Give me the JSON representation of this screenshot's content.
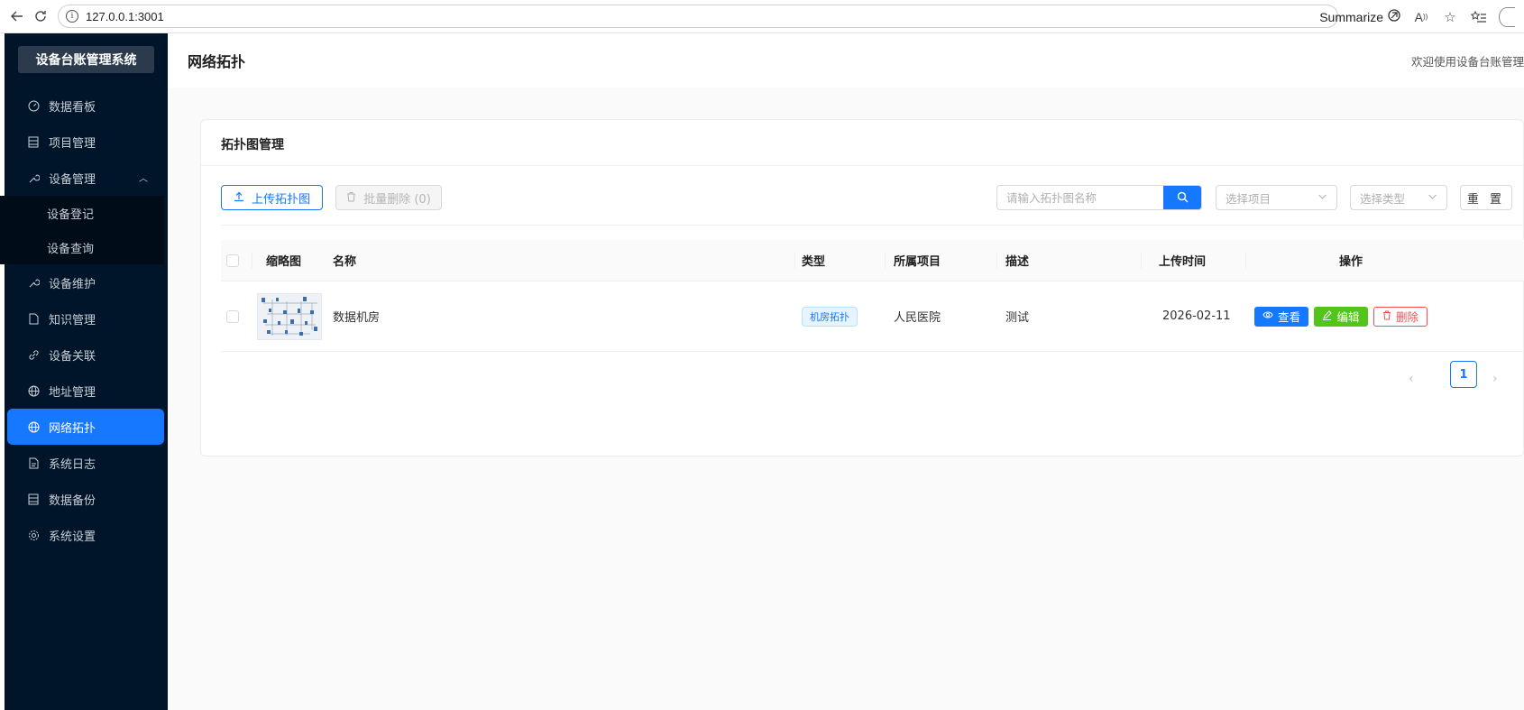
{
  "browser": {
    "url": "127.0.0.1:3001",
    "summarize_label": "Summarize"
  },
  "sidebar": {
    "brand": "设备台账管理系统",
    "items": [
      {
        "label": "数据看板",
        "icon": "dashboard-icon"
      },
      {
        "label": "项目管理",
        "icon": "list-icon"
      },
      {
        "label": "设备管理",
        "icon": "wrench-icon",
        "expanded": true,
        "children": [
          {
            "label": "设备登记"
          },
          {
            "label": "设备查询"
          }
        ]
      },
      {
        "label": "设备维护",
        "icon": "wrench-icon"
      },
      {
        "label": "知识管理",
        "icon": "file-icon"
      },
      {
        "label": "设备关联",
        "icon": "link-icon"
      },
      {
        "label": "地址管理",
        "icon": "globe-icon"
      },
      {
        "label": "网络拓扑",
        "icon": "globe-icon",
        "active": true
      },
      {
        "label": "系统日志",
        "icon": "file-text-icon"
      },
      {
        "label": "数据备份",
        "icon": "list-icon"
      },
      {
        "label": "系统设置",
        "icon": "gear-icon"
      }
    ]
  },
  "header": {
    "title": "网络拓扑",
    "welcome": "欢迎使用设备台账管理"
  },
  "card": {
    "title": "拓扑图管理",
    "upload_label": "上传拓扑图",
    "batch_delete_label": "批量删除 (0)",
    "search_placeholder": "请输入拓扑图名称",
    "project_placeholder": "选择项目",
    "type_placeholder": "选择类型",
    "reset_label": "重 置"
  },
  "table": {
    "columns": [
      "缩略图",
      "名称",
      "类型",
      "所属项目",
      "描述",
      "上传时间",
      "操作"
    ],
    "rows": [
      {
        "name": "数据机房",
        "type": "机房拓扑",
        "project": "人民医院",
        "description": "测试",
        "upload_time": "2026-02-11",
        "actions": {
          "view": "查看",
          "edit": "编辑",
          "delete": "删除"
        }
      }
    ]
  },
  "pagination": {
    "current_page": "1"
  },
  "colors": {
    "sidebar_bg": "#001529",
    "primary": "#1677ff",
    "success": "#52c41a",
    "danger": "#ff4d4f"
  }
}
